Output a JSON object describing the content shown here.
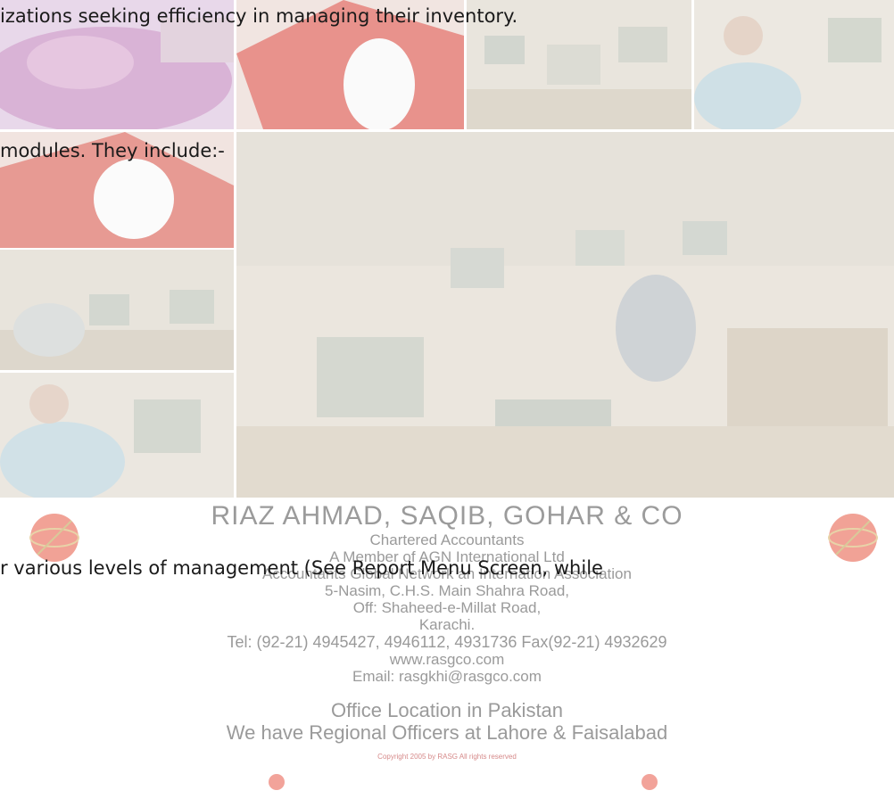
{
  "document": {
    "line_1": "izations seeking efficiency in managing their inventory.",
    "line_2": "modules.  They include:-",
    "line_3": "r  various  levels  of  management  (See  Report  Menu  Screen,  while"
  },
  "letterhead": {
    "firm_name": "RIAZ AHMAD, SAQIB, GOHAR & CO",
    "designation": "Chartered Accountants",
    "member_of": "A Member of AGN International Ltd",
    "network": "Accountants Global Network an Internation Association",
    "address_1": "5-Nasim, C.H.S. Main Shahra Road,",
    "address_2": "Off: Shaheed-e-Millat Road,",
    "city": "Karachi.",
    "phone": "Tel: (92-21) 4945427, 4946112, 4931736 Fax(92-21) 4932629",
    "website": "www.rasgco.com",
    "email": "Email: rasgkhi@rasgco.com",
    "office_location": "Office Location in Pakistan",
    "regional": "We have Regional Officers at Lahore & Faisalabad",
    "copyright": "Copyright 2005 by RASG All rights reserved"
  },
  "colors": {
    "globe_red": "#e8705f",
    "photo_base": "#d9d3c9"
  }
}
